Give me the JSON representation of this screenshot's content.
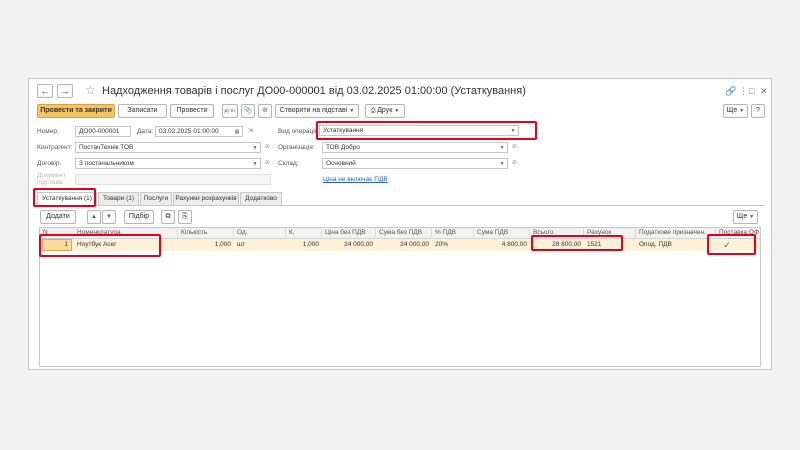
{
  "window": {
    "title": "Надходження товарів і послуг ДО00-000001 від 03.02.2025 01:00:00 (Устаткування)",
    "back_glyph": "←",
    "forward_glyph": "→",
    "star_glyph": "☆",
    "link_glyph": "🔗",
    "menu_glyph": "⋮",
    "restore_glyph": "□",
    "close_glyph": "✕"
  },
  "toolbar": {
    "post_close": "Провести та закрити",
    "save": "Записати",
    "post": "Провести",
    "create_based": "Створити на підставі",
    "print": "Друк",
    "more": "Ще",
    "help": "?",
    "icon_dt_kt": "Дт Кт",
    "icon_attach": "📎",
    "icon_structure": "⊕"
  },
  "form": {
    "number_label": "Номер:",
    "number_value": "ДО00-000001",
    "date_label": "Дата:",
    "date_value": "03.02.2025 01:00:00",
    "operation_label": "Вид операції:",
    "operation_value": "Устаткування",
    "counterparty_label": "Контрагент:",
    "counterparty_value": "ПостачТехнік ТОВ",
    "organization_label": "Організація:",
    "organization_value": "ТОВ Добро",
    "contract_label": "Договір:",
    "contract_value": "З постачальником",
    "warehouse_label": "Склад:",
    "warehouse_value": "Основний",
    "base_doc_label": "Документ підстава:",
    "vat_link": "Ціна не включає ПДВ"
  },
  "tabs": [
    {
      "label": "Устаткування (1)"
    },
    {
      "label": "Товари (1)"
    },
    {
      "label": "Послуги"
    },
    {
      "label": "Рахунки розрахунків"
    },
    {
      "label": "Додатково"
    }
  ],
  "table_toolbar": {
    "add": "Додати",
    "select": "Підбір",
    "more": "Ще",
    "up": "▲",
    "down": "▼",
    "copy": "⧉",
    "paste": "⎘"
  },
  "table": {
    "columns": [
      "N",
      "Номенклатура",
      "Кількість",
      "Од.",
      "К.",
      "Ціна без ПДВ",
      "Сума без ПДВ",
      "% ПДВ",
      "Сума ПДВ",
      "Всього",
      "Рахунок",
      "Податкове призначен.",
      "Поставка ОФ"
    ],
    "rows": [
      {
        "n": "1",
        "item": "Ноутбук Acer",
        "qty": "1,000",
        "unit": "шт",
        "coef": "1,000",
        "price": "24 000,00",
        "sum_no_vat": "24 000,00",
        "vat_rate": "20%",
        "vat_sum": "4 800,00",
        "total": "28 800,00",
        "account": "1521",
        "tax_purpose": "Опод. ПДВ",
        "delivery_check": "✓"
      }
    ]
  },
  "colors": {
    "accent_button": "#f7c55d",
    "annotation": "#e5001b",
    "selected_row": "#fdf1d8",
    "link": "#2a62b8"
  }
}
